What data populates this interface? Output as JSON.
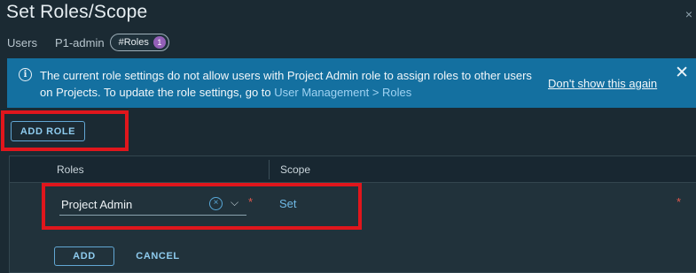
{
  "dialog": {
    "title": "Set Roles/Scope",
    "close_glyph": "×"
  },
  "breadcrumb": {
    "users": "Users",
    "user": "P1-admin",
    "roles_pill": "#Roles",
    "roles_count": "1"
  },
  "banner": {
    "info_glyph": "i",
    "message": "The current role settings do not allow users with Project Admin role to assign roles to other users on Projects. To update the role settings, go to ",
    "link": "User Management > Roles",
    "dont_show": "Don't show this again",
    "close_glyph": "✕",
    "color": "#1470a0"
  },
  "actions": {
    "add_role": "ADD ROLE"
  },
  "table": {
    "columns": [
      "Roles",
      "Scope"
    ],
    "row": {
      "role_value": "Project Admin",
      "clear_glyph": "×",
      "dropdown_glyph": "⌵",
      "required": "*",
      "scope_link": "Set",
      "scope_required": "*"
    },
    "add": "ADD",
    "cancel": "CANCEL"
  },
  "colors": {
    "background": "#1b2a33",
    "accent": "#62a7d4",
    "highlight": "#e0161c",
    "badge": "#9460b8"
  }
}
